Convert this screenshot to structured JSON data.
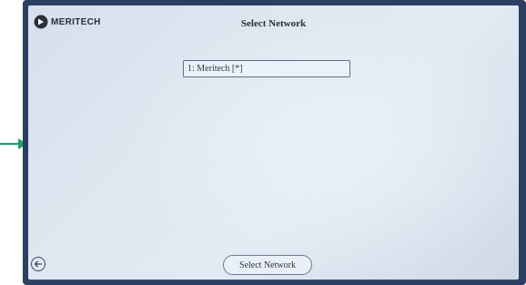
{
  "header": {
    "brand": "MERITECH",
    "title": "Select Network"
  },
  "networks": {
    "items": [
      {
        "label": "1: Meritech [*]"
      }
    ]
  },
  "footer": {
    "back_icon": "back-arrow-icon",
    "select_label": "Select Network"
  },
  "colors": {
    "frame": "#2b3f63",
    "screen": "#dfe7f1",
    "pointer": "#1fa36a"
  }
}
